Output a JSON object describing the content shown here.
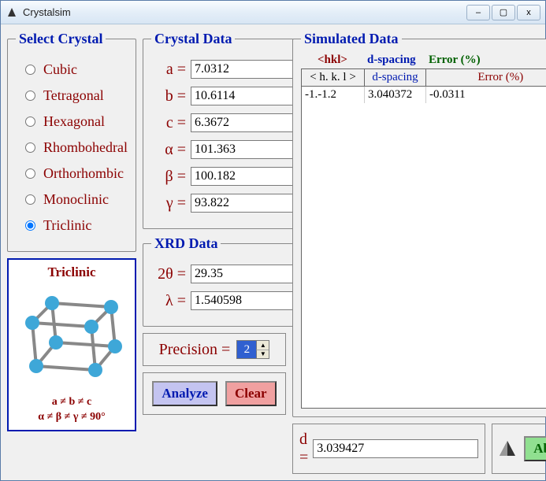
{
  "window": {
    "title": "Crystalsim"
  },
  "select_crystal": {
    "legend": "Select Crystal",
    "options": [
      "Cubic",
      "Tetragonal",
      "Hexagonal",
      "Rhombohedral",
      "Orthorhombic",
      "Monoclinic",
      "Triclinic"
    ],
    "selected": "Triclinic"
  },
  "crystal_preview": {
    "name": "Triclinic",
    "formula1": "a ≠ b ≠ c",
    "formula2": "α ≠ β ≠ γ ≠ 90°"
  },
  "crystal_data": {
    "legend": "Crystal Data",
    "a_label": "a =",
    "a": "7.0312",
    "b_label": "b =",
    "b": "10.6114",
    "c_label": "c =",
    "c": "6.3672",
    "alpha_label": "α =",
    "alpha": "101.363",
    "beta_label": "β =",
    "beta": "100.182",
    "gamma_label": "γ =",
    "gamma": "93.822"
  },
  "xrd_data": {
    "legend": "XRD Data",
    "two_theta_label": "2θ =",
    "two_theta": "29.35",
    "lambda_label": "λ =",
    "lambda": "1.540598"
  },
  "precision": {
    "label": "Precision =",
    "value": "2"
  },
  "buttons": {
    "analyze": "Analyze",
    "clear": "Clear",
    "about": "About"
  },
  "simulated": {
    "legend": "Simulated Data",
    "head_hkl": "<hkl>",
    "head_d": "d-spacing",
    "head_err": "Error (%)",
    "col_hkl": "< h. k. l >",
    "col_d": "d-spacing",
    "col_err": "Error (%)",
    "rows": [
      {
        "hkl": "-1.-1.2",
        "d": "3.040372",
        "err": "-0.0311"
      }
    ]
  },
  "d_result": {
    "label": "d =",
    "value": "3.039427"
  }
}
